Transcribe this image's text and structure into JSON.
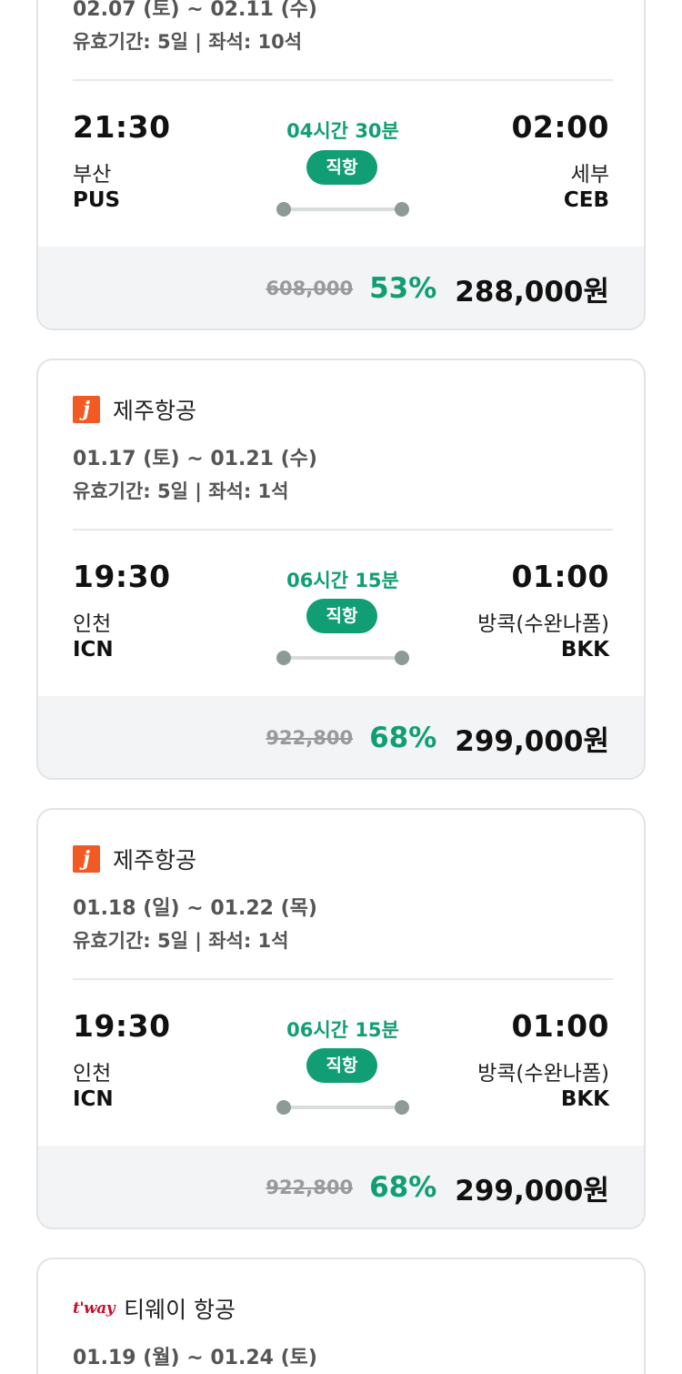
{
  "cards": [
    {
      "airline": "",
      "dates": "02.07 (토) ~ 02.11 (수)",
      "validity": "유효기간: 5일 | 좌석: 10석",
      "departure_time": "21:30",
      "arrival_time": "02:00",
      "duration": "04시간 30분",
      "direct_label": "직항",
      "from_city": "부산",
      "from_code": "PUS",
      "to_city": "세부",
      "to_code": "CEB",
      "original_price": "608,000",
      "discount": "53%",
      "price": "288,000원"
    },
    {
      "airline": "제주항공",
      "logo_icon": "jeju-air-logo",
      "logo_text": "j",
      "dates": "01.17 (토) ~ 01.21 (수)",
      "validity": "유효기간: 5일 | 좌석: 1석",
      "departure_time": "19:30",
      "arrival_time": "01:00",
      "duration": "06시간 15분",
      "direct_label": "직항",
      "from_city": "인천",
      "from_code": "ICN",
      "to_city": "방콕(수완나폼)",
      "to_code": "BKK",
      "original_price": "922,800",
      "discount": "68%",
      "price": "299,000원"
    },
    {
      "airline": "제주항공",
      "logo_icon": "jeju-air-logo",
      "logo_text": "j",
      "dates": "01.18 (일) ~ 01.22 (목)",
      "validity": "유효기간: 5일 | 좌석: 1석",
      "departure_time": "19:30",
      "arrival_time": "01:00",
      "duration": "06시간 15분",
      "direct_label": "직항",
      "from_city": "인천",
      "from_code": "ICN",
      "to_city": "방콕(수완나폼)",
      "to_code": "BKK",
      "original_price": "922,800",
      "discount": "68%",
      "price": "299,000원"
    },
    {
      "airline": "티웨이 항공",
      "logo_icon": "tway-logo",
      "logo_text": "t'way",
      "dates": "01.19 (월) ~ 01.24 (토)"
    }
  ],
  "colors": {
    "accent": "#119e74",
    "jeju_orange": "#f15a22",
    "tway_red": "#c8102e",
    "price_bg": "#f3f4f5"
  }
}
